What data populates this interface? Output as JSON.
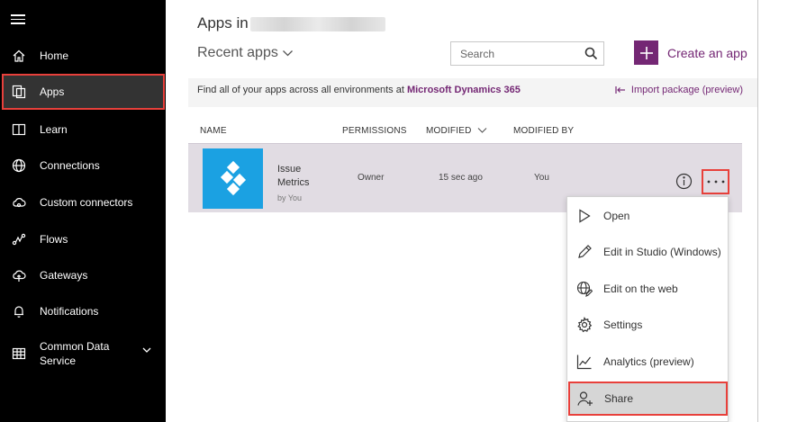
{
  "sidebar": {
    "items": [
      {
        "label": "Home",
        "icon": "home-icon"
      },
      {
        "label": "Apps",
        "icon": "apps-icon"
      },
      {
        "label": "Learn",
        "icon": "book-icon"
      },
      {
        "label": "Connections",
        "icon": "globe-icon"
      },
      {
        "label": "Custom connectors",
        "icon": "cloud-gear-icon"
      },
      {
        "label": "Flows",
        "icon": "flow-icon"
      },
      {
        "label": "Gateways",
        "icon": "cloud-upload-icon"
      },
      {
        "label": "Notifications",
        "icon": "bell-icon"
      },
      {
        "label": "Common Data Service",
        "icon": "table-icon"
      }
    ],
    "selected": "Apps"
  },
  "header": {
    "title": "Apps in",
    "view_selector": "Recent apps",
    "search_placeholder": "Search",
    "create_label": "Create an app"
  },
  "infobar": {
    "text": "Find all of your apps across all environments at ",
    "link": "Microsoft Dynamics 365",
    "import_label": "Import package (preview)"
  },
  "table": {
    "columns": [
      "NAME",
      "PERMISSIONS",
      "MODIFIED",
      "MODIFIED BY"
    ],
    "rows": [
      {
        "name_line1": "Issue",
        "name_line2": "Metrics",
        "owner": "by You",
        "permissions": "Owner",
        "modified": "15 sec ago",
        "modified_by": "You"
      }
    ]
  },
  "context_menu": {
    "items": [
      {
        "label": "Open",
        "icon": "play-icon"
      },
      {
        "label": "Edit in Studio (Windows)",
        "icon": "pencil-icon"
      },
      {
        "label": "Edit on the web",
        "icon": "web-edit-icon"
      },
      {
        "label": "Settings",
        "icon": "gear-icon"
      },
      {
        "label": "Analytics (preview)",
        "icon": "analytics-icon"
      },
      {
        "label": "Share",
        "icon": "share-user-icon"
      }
    ],
    "selected": "Share"
  },
  "colors": {
    "sidebar_bg": "#000000",
    "accent": "#742774",
    "highlight_border": "#e8403b",
    "app_tile": "#1ba1e2",
    "row_bg": "#e1dce3"
  }
}
